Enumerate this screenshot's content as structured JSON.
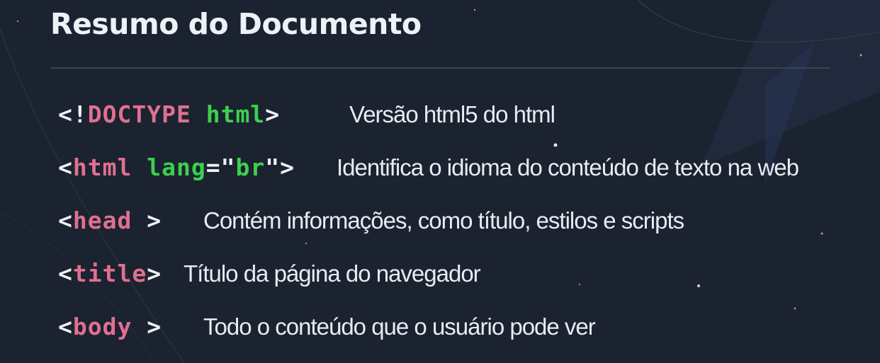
{
  "slide": {
    "title": "Resumo do Documento"
  },
  "items": [
    {
      "tokens": [
        "<!",
        "DOCTYPE",
        " ",
        "html",
        ">"
      ],
      "description": "Versão html5 do html"
    },
    {
      "tokens": [
        "<",
        "html",
        " ",
        "lang",
        "=\"",
        "br",
        "\">"
      ],
      "description": "Identifica o idioma do conteúdo de texto na web"
    },
    {
      "tokens": [
        "<",
        "head",
        " >"
      ],
      "description": "Contém informações, como título, estilos e scripts"
    },
    {
      "tokens": [
        "<",
        "title",
        ">"
      ],
      "description": "Título da página do navegador"
    },
    {
      "tokens": [
        "<",
        "body",
        " >"
      ],
      "description": "Todo o conteúdo que o usuário pode ver"
    }
  ],
  "colors": {
    "background": "#1b2230",
    "tag_name": "#e0708f",
    "attribute": "#3ad14d",
    "punctuation": "#eef1f5",
    "text": "#e8ebf0"
  }
}
